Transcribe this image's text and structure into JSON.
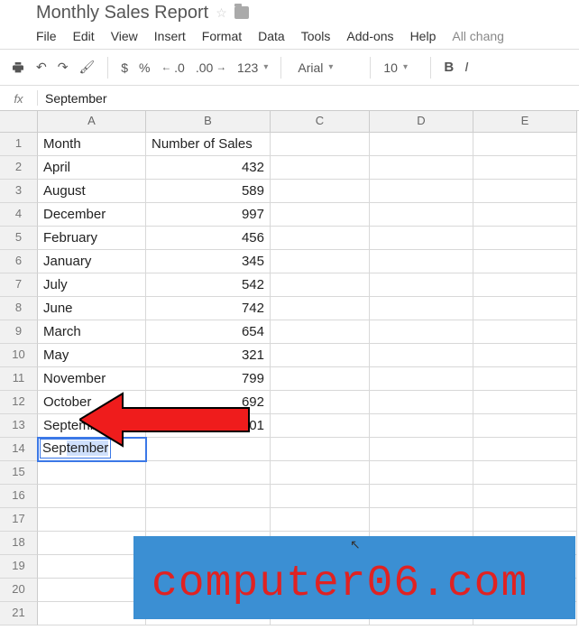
{
  "doc": {
    "title": "Monthly Sales Report"
  },
  "menu": {
    "file": "File",
    "edit": "Edit",
    "view": "View",
    "insert": "Insert",
    "format": "Format",
    "data": "Data",
    "tools": "Tools",
    "addons": "Add-ons",
    "help": "Help",
    "allchanges": "All chang"
  },
  "toolbar": {
    "currency": "$",
    "percent": "%",
    "dec_dec": ".0",
    "dec_inc": ".00",
    "numfmt": "123",
    "font": "Arial",
    "fontsize": "10",
    "bold": "B",
    "italic": "I"
  },
  "fx": {
    "label": "fx",
    "value": "September"
  },
  "columns": [
    "A",
    "B",
    "C",
    "D",
    "E"
  ],
  "rows_count": 21,
  "active_cell": {
    "row": 14,
    "col": "A",
    "typed": "Sep",
    "suggest": "tember"
  },
  "sheet": [
    {
      "a": "Month",
      "b": "Number of Sales"
    },
    {
      "a": "April",
      "b": "432"
    },
    {
      "a": "August",
      "b": "589"
    },
    {
      "a": "December",
      "b": "997"
    },
    {
      "a": "February",
      "b": "456"
    },
    {
      "a": "January",
      "b": "345"
    },
    {
      "a": "July",
      "b": "542"
    },
    {
      "a": "June",
      "b": "742"
    },
    {
      "a": "March",
      "b": "654"
    },
    {
      "a": "May",
      "b": "321"
    },
    {
      "a": "November",
      "b": "799"
    },
    {
      "a": "October",
      "b": "692"
    },
    {
      "a": "September",
      "b": "601"
    },
    {
      "a": "",
      "b": ""
    },
    {
      "a": "",
      "b": ""
    },
    {
      "a": "",
      "b": ""
    },
    {
      "a": "",
      "b": ""
    },
    {
      "a": "",
      "b": ""
    },
    {
      "a": "",
      "b": ""
    },
    {
      "a": "",
      "b": ""
    },
    {
      "a": "",
      "b": ""
    }
  ],
  "watermark": "computer06.com"
}
